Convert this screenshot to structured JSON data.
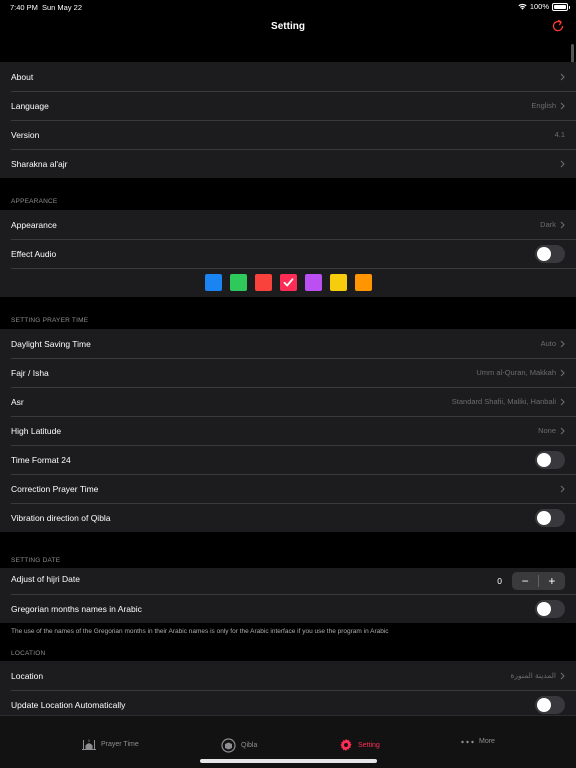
{
  "status": {
    "time": "7:40 PM",
    "date": "Sun May 22",
    "battery": "100%"
  },
  "nav": {
    "title": "Setting"
  },
  "general": [
    {
      "label": "About",
      "value": ""
    },
    {
      "label": "Language",
      "value": "English"
    },
    {
      "label": "Version",
      "value": "4.1"
    },
    {
      "label": "Sharakna al'ajr",
      "value": ""
    }
  ],
  "appearance": {
    "header": "APPEARANCE",
    "appearance_label": "Appearance",
    "appearance_value": "Dark",
    "effect_audio_label": "Effect Audio",
    "effect_audio_on": false,
    "colors": [
      "#1a84f2",
      "#2fc85a",
      "#f9423c",
      "#ff2d55",
      "#bb4ff2",
      "#f7cc0c",
      "#ff9500"
    ],
    "selected_color": "#ff2d55"
  },
  "prayer": {
    "header": "SETTING PRAYER TIME",
    "daylight_label": "Daylight Saving Time",
    "daylight_value": "Auto",
    "fajr_label": "Fajr / Isha",
    "fajr_value": "Umm al-Quran, Makkah",
    "asr_label": "Asr",
    "asr_value": "Standard Shafii, Maliki, Hanbali",
    "high_lat_label": "High Latitude",
    "high_lat_value": "None",
    "time_format_label": "Time Format 24",
    "time_format_on": false,
    "correction_label": "Correction Prayer Time",
    "vibration_label": "Vibration direction of Qibla",
    "vibration_on": false
  },
  "date": {
    "header": "SETTING DATE",
    "hijri_label": "Adjust of hijri Date",
    "hijri_value": "0",
    "minus": "−",
    "plus": "+",
    "greg_label": "Gregorian months names in Arabic",
    "greg_on": false,
    "note": "The use of the names of the Gregorian months in their Arabic names is only for the Arabic interface if you use the program in Arabic"
  },
  "location": {
    "header": "LOCATION",
    "location_label": "Location",
    "location_value": "المدينة المنورة",
    "update_label": "Update Location Automatically",
    "update_on": false
  },
  "tabs": {
    "prayer": "Prayer Time",
    "qibla": "Qibla",
    "setting": "Setting",
    "more": "More"
  },
  "accent_color": "#ff2d55"
}
